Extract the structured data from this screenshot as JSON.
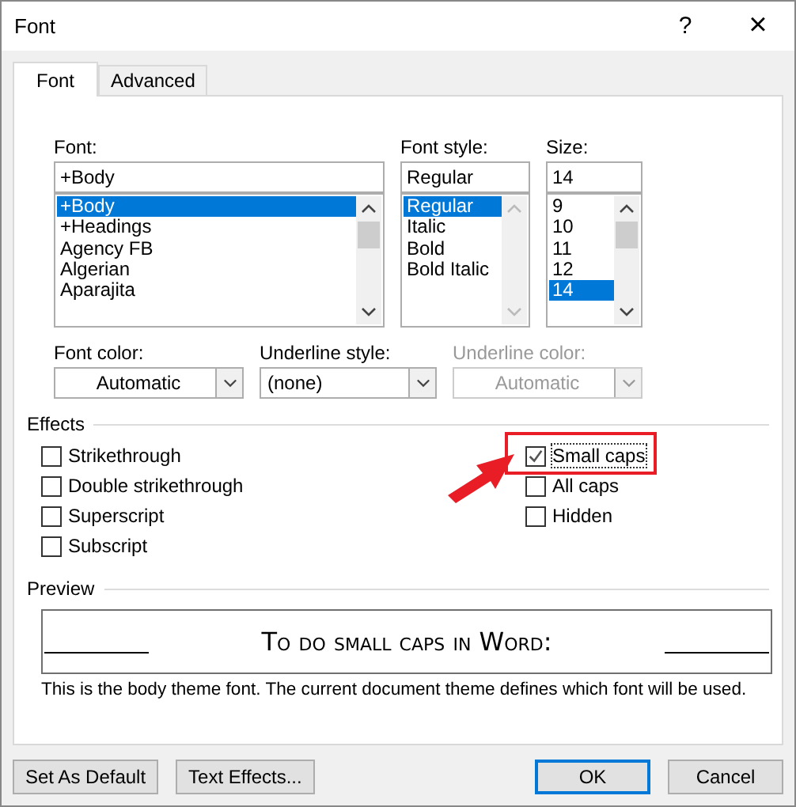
{
  "window": {
    "title": "Font",
    "help": "?",
    "close": "×"
  },
  "tabs": [
    {
      "label": "Font",
      "selected": true
    },
    {
      "label": "Advanced",
      "selected": false
    }
  ],
  "lists": [
    {
      "label": "Font:",
      "value": "+Body",
      "scrollable": true,
      "items": [
        {
          "label": "+Body",
          "selected": true
        },
        {
          "label": "+Headings",
          "selected": false
        },
        {
          "label": "Agency FB",
          "selected": false
        },
        {
          "label": "Algerian",
          "selected": false
        },
        {
          "label": "Aparajita",
          "selected": false
        }
      ]
    },
    {
      "label": "Font style:",
      "value": "Regular",
      "scrollable": false,
      "items": [
        {
          "label": "Regular",
          "selected": true
        },
        {
          "label": "Italic",
          "selected": false
        },
        {
          "label": "Bold",
          "selected": false
        },
        {
          "label": "Bold Italic",
          "selected": false
        }
      ]
    },
    {
      "label": "Size:",
      "value": "14",
      "scrollable": true,
      "items": [
        {
          "label": "9",
          "selected": false
        },
        {
          "label": "10",
          "selected": false
        },
        {
          "label": "11",
          "selected": false
        },
        {
          "label": "12",
          "selected": false
        },
        {
          "label": "14",
          "selected": true
        }
      ]
    }
  ],
  "dropdowns": [
    {
      "label": "Font color:",
      "value": "Automatic",
      "kind": "color",
      "disabled": false
    },
    {
      "label": "Underline style:",
      "value": "(none)",
      "kind": "select",
      "disabled": false
    },
    {
      "label": "Underline color:",
      "value": "Automatic",
      "kind": "color",
      "disabled": true
    }
  ],
  "effects": {
    "title": "Effects",
    "columns": [
      [
        {
          "label": "Strikethrough",
          "checked": false,
          "highlighted": false
        },
        {
          "label": "Double strikethrough",
          "checked": false,
          "highlighted": false
        },
        {
          "label": "Superscript",
          "checked": false,
          "highlighted": false
        },
        {
          "label": "Subscript",
          "checked": false,
          "highlighted": false
        }
      ],
      [
        {
          "label": "Small caps",
          "checked": true,
          "highlighted": true
        },
        {
          "label": "All caps",
          "checked": false,
          "highlighted": false
        },
        {
          "label": "Hidden",
          "checked": false,
          "highlighted": false
        }
      ]
    ]
  },
  "preview": {
    "title": "Preview",
    "sample": "To do small caps in Word:",
    "note": "This is the body theme font. The current document theme defines which font will be used."
  },
  "buttons_left": [
    {
      "label": "Set As Default",
      "default": false
    },
    {
      "label": "Text Effects...",
      "default": false
    }
  ],
  "buttons_right": [
    {
      "label": "OK",
      "default": true
    },
    {
      "label": "Cancel",
      "default": false
    }
  ]
}
